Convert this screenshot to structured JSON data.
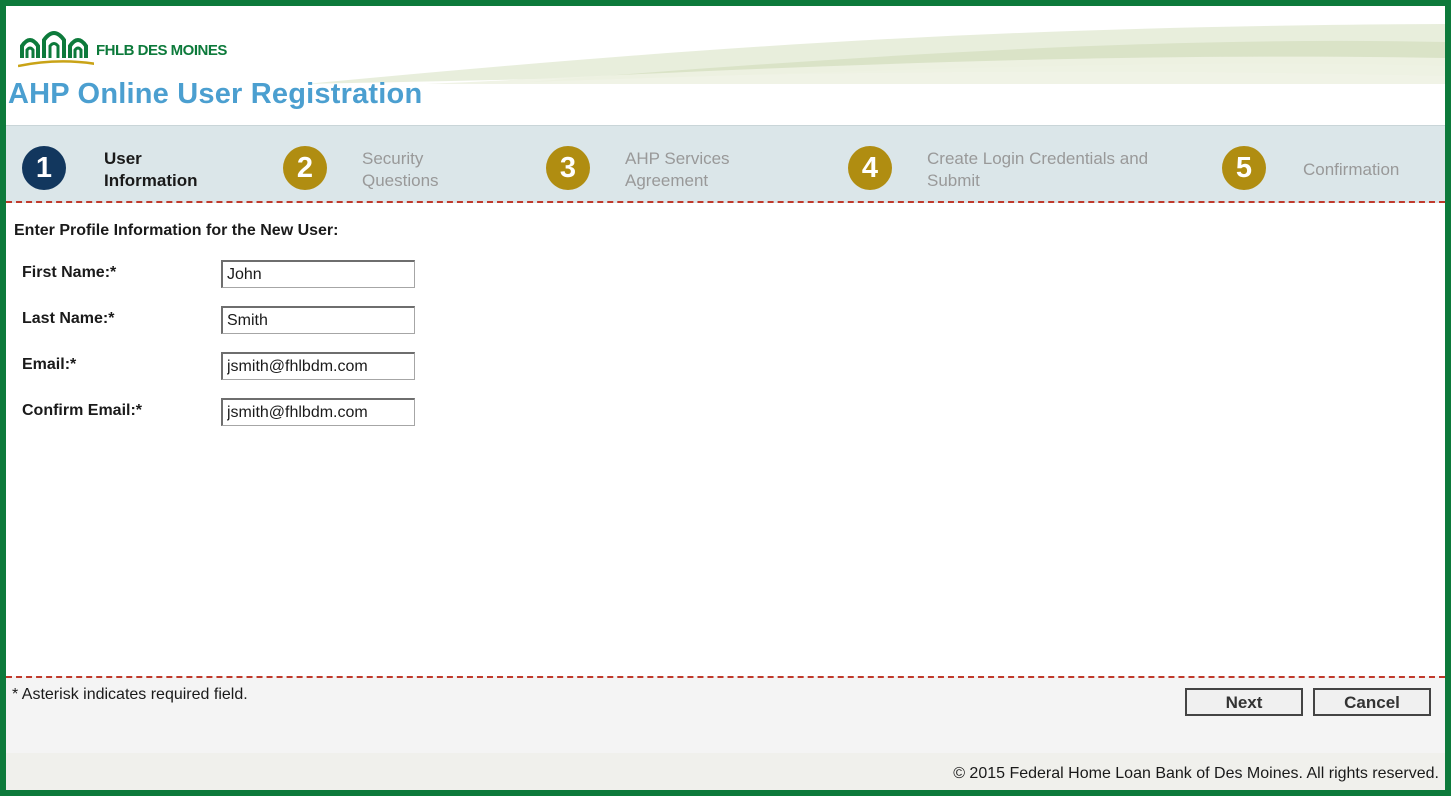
{
  "brand": {
    "logo_text": "FHLB DES MOINES",
    "primary_color": "#0d7a3b",
    "title_color": "#4b9fd0"
  },
  "page": {
    "title": "AHP Online User Registration"
  },
  "steps": [
    {
      "number": "1",
      "label_line1": "User",
      "label_line2": "Information",
      "state": "active"
    },
    {
      "number": "2",
      "label_line1": "Security",
      "label_line2": "Questions",
      "state": "pending"
    },
    {
      "number": "3",
      "label_line1": "AHP Services",
      "label_line2": "Agreement",
      "state": "pending"
    },
    {
      "number": "4",
      "label_line1": "Create Login Credentials and",
      "label_line2": "Submit",
      "state": "pending"
    },
    {
      "number": "5",
      "label_line1": "Confirmation",
      "label_line2": "",
      "state": "pending"
    }
  ],
  "form": {
    "heading": "Enter Profile Information for the New User:",
    "fields": [
      {
        "label": "First Name:*",
        "value": "John"
      },
      {
        "label": "Last Name:*",
        "value": "Smith"
      },
      {
        "label": "Email:*",
        "value": "jsmith@fhlbdm.com"
      },
      {
        "label": "Confirm Email:*",
        "value": "jsmith@fhlbdm.com"
      }
    ]
  },
  "footer": {
    "required_note": "* Asterisk indicates required field.",
    "next_label": "Next",
    "cancel_label": "Cancel",
    "copyright": "© 2015 Federal Home Loan Bank of Des Moines. All rights reserved."
  }
}
